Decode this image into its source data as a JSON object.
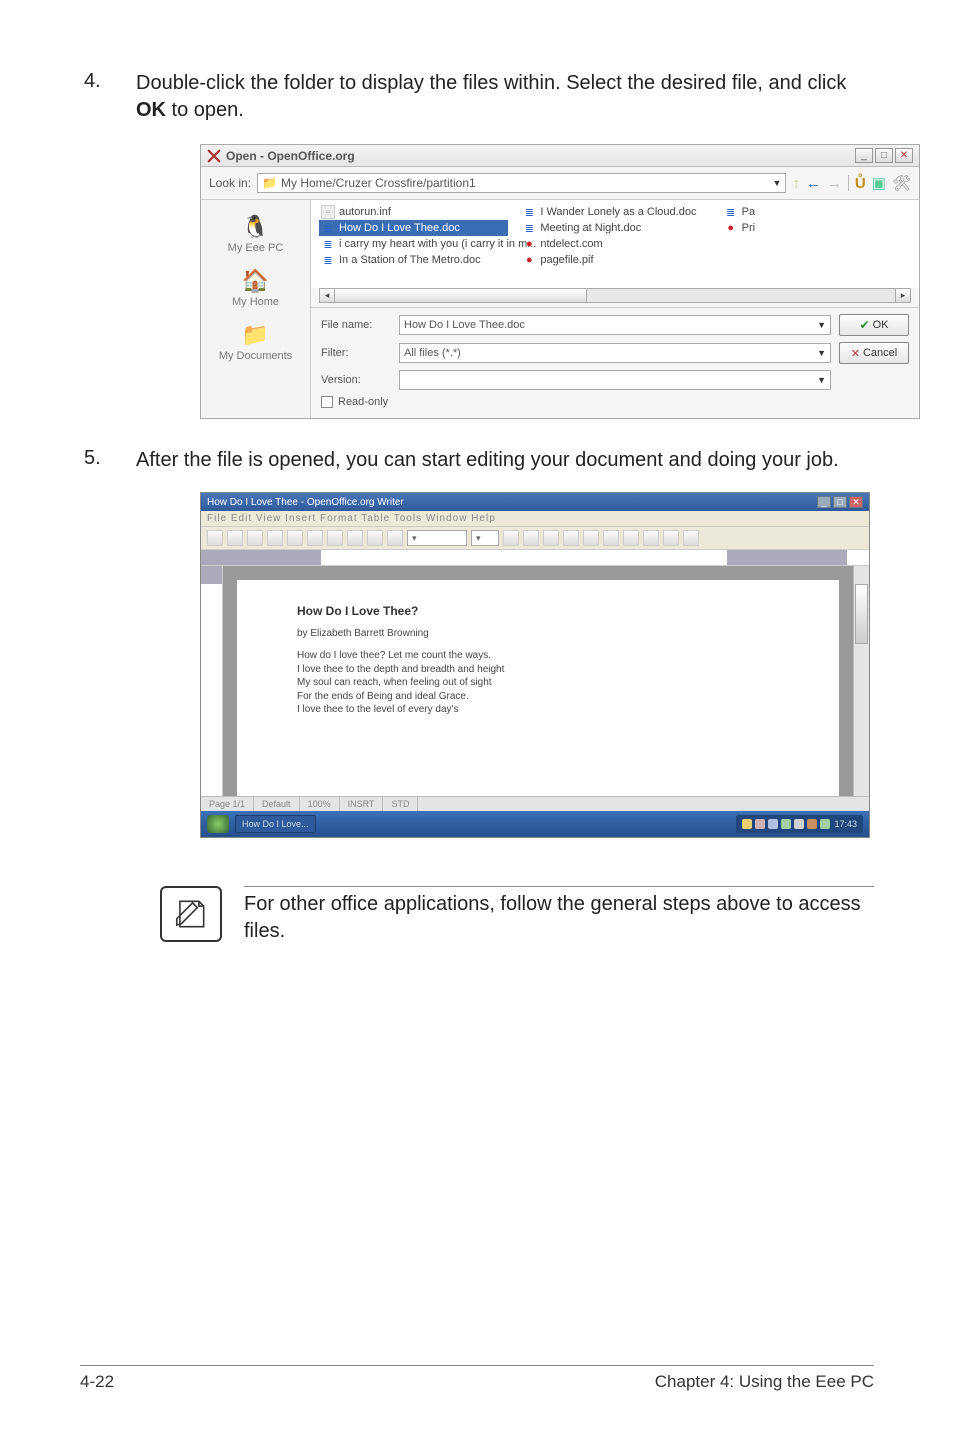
{
  "steps": {
    "s4": {
      "num": "4.",
      "text_a": "Double-click the folder to display the files within. Select the desired file, and click ",
      "bold": "OK",
      "text_b": " to open."
    },
    "s5": {
      "num": "5.",
      "text": "After the file is opened, you can start editing your document and doing your job."
    }
  },
  "open_dialog": {
    "title": "Open - OpenOffice.org",
    "lookin_label": "Look in:",
    "lookin_value": "My Home/Cruzer Crossfire/partition1",
    "places": [
      {
        "label": "My Eee PC",
        "glyph": "🐧"
      },
      {
        "label": "My Home",
        "glyph": "🏠"
      },
      {
        "label": "My Documents",
        "glyph": "📁"
      }
    ],
    "file_cols": [
      [
        {
          "ic": "inf",
          "name": "autorun.inf"
        },
        {
          "ic": "doc",
          "name": "How Do I Love Thee.doc",
          "sel": true
        },
        {
          "ic": "doc",
          "name": "i carry my heart with you (i carry it in m..."
        },
        {
          "ic": "doc",
          "name": "In a Station of The Metro.doc"
        }
      ],
      [
        {
          "ic": "doc",
          "name": "I Wander Lonely as a Cloud.doc"
        },
        {
          "ic": "doc",
          "name": "Meeting at Night.doc"
        },
        {
          "ic": "app",
          "name": "ntdelect.com"
        },
        {
          "ic": "app",
          "name": "pagefile.pif"
        }
      ],
      [
        {
          "ic": "doc",
          "name": "Pa"
        },
        {
          "ic": "app",
          "name": "Pri"
        }
      ]
    ],
    "filename_label": "File name:",
    "filename_value": "How Do I Love Thee.doc",
    "filter_label": "Filter:",
    "filter_value": "All files (*.*)",
    "version_label": "Version:",
    "version_value": "",
    "readonly_label": "Read-only",
    "ok": "OK",
    "cancel": "Cancel"
  },
  "writer": {
    "title": "How Do I Love Thee - OpenOffice.org Writer",
    "menu": "File  Edit  View  Insert  Format  Table  Tools  Window  Help",
    "doc_title": "How Do I Love Thee?",
    "byline": "by Elizabeth Barrett Browning",
    "body_lines": [
      "How do I love thee? Let me count the ways.",
      "I love thee to the depth and breadth and height",
      "My soul can reach, when feeling out of sight",
      "For the ends of Being and ideal Grace.",
      "I love thee to the level of every day's"
    ],
    "status_left": "Page 1/1",
    "status_mid": "Default",
    "taskbar_item": "How Do I Love...",
    "clock": "17:43",
    "tray_icons": [
      "#e8d070",
      "#d0b0b0",
      "#b0c0e0",
      "#a0d0a0",
      "#d0d0d0",
      "#c89060",
      "#a0d0a0"
    ]
  },
  "note": {
    "text": "For other office applications, follow the general steps above to access files."
  },
  "footer": {
    "left": "4-22",
    "right": "Chapter 4: Using the Eee PC"
  }
}
